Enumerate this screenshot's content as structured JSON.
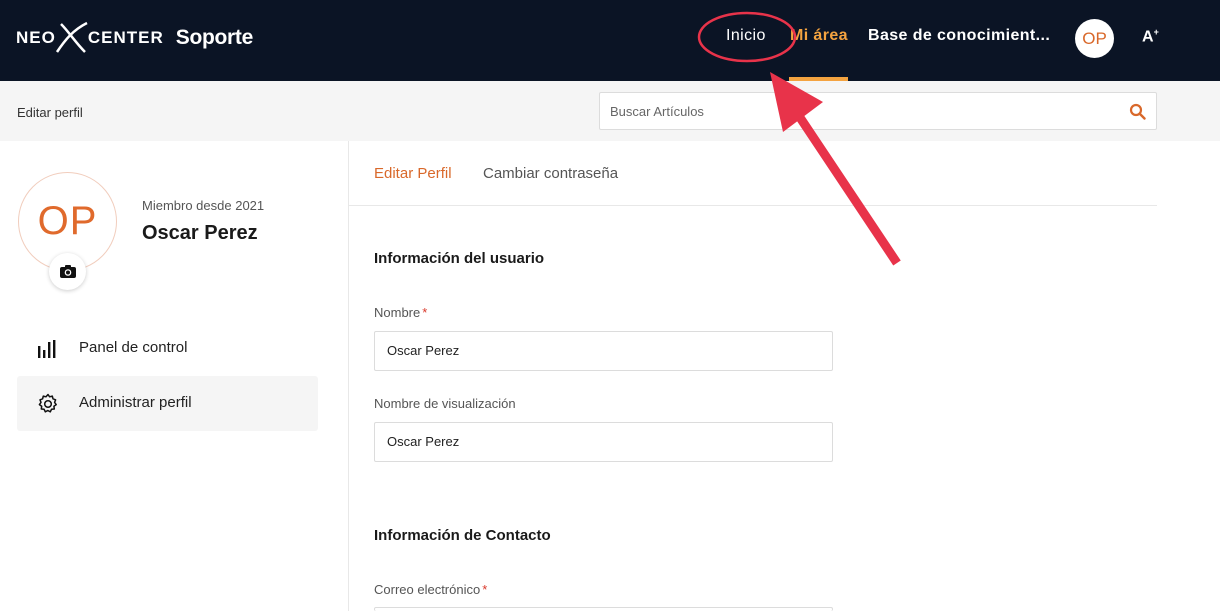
{
  "header": {
    "logo_left": "NEO",
    "logo_right": "CENTER",
    "logo_product": "Soporte",
    "nav": {
      "inicio": "Inicio",
      "mi_area": "Mi área",
      "base": "Base de conocimient..."
    },
    "avatar_initials": "OP",
    "font_size_label": "A",
    "font_size_sup": "+",
    "accent_color": "#f4a340",
    "bg_color": "#0b1425"
  },
  "subbar": {
    "title": "Editar perfil",
    "search_placeholder": "Buscar Artículos"
  },
  "profile": {
    "initials": "OP",
    "member_since": "Miembro desde 2021",
    "name": "Oscar Perez"
  },
  "sidebar": {
    "items": [
      {
        "label": "Panel de control",
        "icon": "bar-chart-icon",
        "active": false
      },
      {
        "label": "Administrar perfil",
        "icon": "gear-icon",
        "active": true
      }
    ]
  },
  "tabs": {
    "edit": "Editar Perfil",
    "password": "Cambiar contraseña"
  },
  "form": {
    "user_section": "Información del usuario",
    "name_label": "Nombre",
    "name_value": "Oscar Perez",
    "display_label": "Nombre de visualización",
    "display_value": "Oscar Perez",
    "contact_section": "Información de Contacto",
    "email_label": "Correo electrónico",
    "required_mark": "*"
  },
  "annotation_color": "#e8334a"
}
